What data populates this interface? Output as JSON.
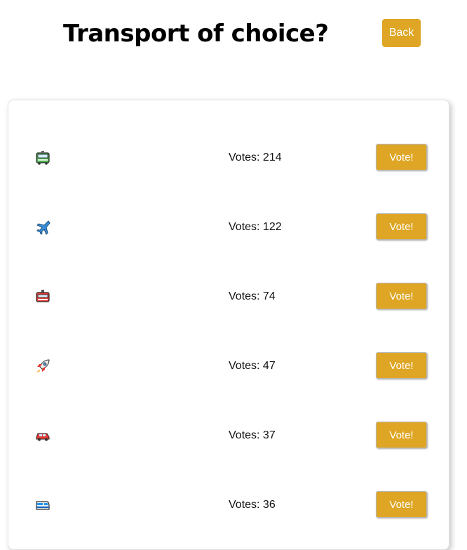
{
  "header": {
    "title": "Transport of choice?",
    "back_label": "Back"
  },
  "colors": {
    "accent": "#dfa625",
    "text": "#111111",
    "card_border": "#e2e2e2"
  },
  "options": [
    {
      "icon": "bus-icon",
      "votes_text": "Votes: 214",
      "vote_label": "Vote!"
    },
    {
      "icon": "airplane-icon",
      "votes_text": "Votes: 122",
      "vote_label": "Vote!"
    },
    {
      "icon": "tram-car-icon",
      "votes_text": "Votes: 74",
      "vote_label": "Vote!"
    },
    {
      "icon": "rocket-icon",
      "votes_text": "Votes: 47",
      "vote_label": "Vote!"
    },
    {
      "icon": "car-icon",
      "votes_text": "Votes: 37",
      "vote_label": "Vote!"
    },
    {
      "icon": "train-icon",
      "votes_text": "Votes: 36",
      "vote_label": "Vote!"
    }
  ]
}
